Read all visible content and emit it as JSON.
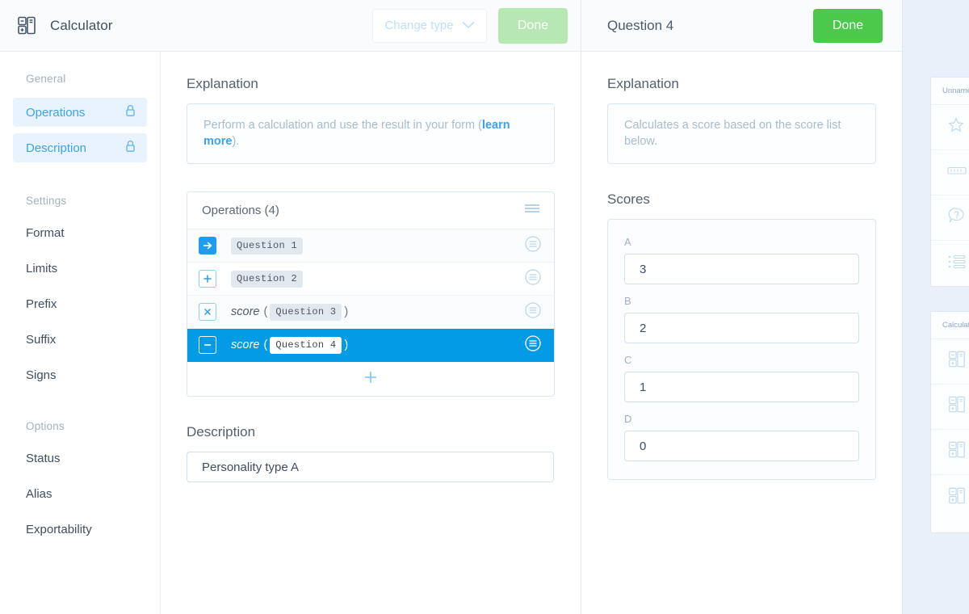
{
  "editor": {
    "icon": "calculator-icon",
    "title": "Calculator",
    "change_type_label": "Change type",
    "change_type_icon": "chevron-down-icon",
    "done_label": "Done",
    "sidebar": {
      "groups": [
        {
          "label": "General",
          "items": [
            {
              "label": "Operations",
              "active": true,
              "icon": "lock-icon"
            },
            {
              "label": "Description",
              "active": true,
              "icon": "lock-icon"
            }
          ]
        },
        {
          "label": "Settings",
          "items": [
            {
              "label": "Format"
            },
            {
              "label": "Limits"
            },
            {
              "label": "Prefix"
            },
            {
              "label": "Suffix"
            },
            {
              "label": "Signs"
            }
          ]
        },
        {
          "label": "Options",
          "items": [
            {
              "label": "Status"
            },
            {
              "label": "Alias"
            },
            {
              "label": "Exportability"
            }
          ]
        }
      ]
    },
    "explanation": {
      "title": "Explanation",
      "text_before": "Perform a calculation and use the result in your form (",
      "link": "learn more",
      "text_after": ")."
    },
    "operations": {
      "title": "Operations (4)",
      "grip_icon": "drag-handle-icon",
      "rows": [
        {
          "op_icon": "arrow-right-icon",
          "op_symbol": "→",
          "style": "filled",
          "fn": "",
          "tag": "Question 1",
          "selected": false
        },
        {
          "op_icon": "plus-icon",
          "op_symbol": "+",
          "style": "outline",
          "fn": "",
          "tag": "Question 2",
          "selected": false
        },
        {
          "op_icon": "multiply-icon",
          "op_symbol": "×",
          "style": "outline",
          "fn": "score",
          "tag": "Question 3",
          "selected": false
        },
        {
          "op_icon": "minus-icon",
          "op_symbol": "−",
          "style": "outline-white",
          "fn": "score",
          "tag": "Question 4",
          "selected": true
        }
      ],
      "add_icon": "plus-icon",
      "open_paren": "(",
      "close_paren": ")"
    },
    "description": {
      "title": "Description",
      "value": "Personality type A"
    }
  },
  "question_panel": {
    "title": "Question 4",
    "done_label": "Done",
    "explanation": {
      "title": "Explanation",
      "text": "Calculates a score based on the score list below."
    },
    "scores": {
      "title": "Scores",
      "items": [
        {
          "label": "A",
          "value": "3"
        },
        {
          "label": "B",
          "value": "2"
        },
        {
          "label": "C",
          "value": "1"
        },
        {
          "label": "D",
          "value": "0"
        }
      ]
    }
  },
  "right_strip": {
    "cards": [
      {
        "title": "Unnamed",
        "rows": [
          {
            "icon": "star-rating-icon"
          },
          {
            "icon": "slider-scale-icon"
          },
          {
            "icon": "opinion-bubble-icon"
          },
          {
            "icon": "checklist-icon"
          }
        ]
      },
      {
        "title": "Calculator",
        "rows": [
          {
            "icon": "calculator-icon"
          },
          {
            "icon": "calculator-icon"
          },
          {
            "icon": "calculator-icon"
          },
          {
            "icon": "calculator-icon"
          }
        ]
      }
    ]
  },
  "colors": {
    "accent_blue": "#039be5",
    "link_blue": "#3ba3ea",
    "done_green": "#4ac94a",
    "done_green_disabled": "#b7e8b4",
    "panel_bg": "#e9f0fa"
  }
}
